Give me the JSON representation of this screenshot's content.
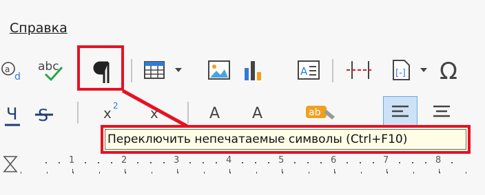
{
  "menu": {
    "help_label": "Справка"
  },
  "tooltip": {
    "text": "Переключить непечатаемые символы (Ctrl+F10)"
  },
  "ruler": {
    "labels": [
      "1",
      "2",
      "3",
      "4",
      "5",
      "6",
      "7",
      "8"
    ]
  },
  "colors": {
    "highlight": "#e81123",
    "tooltip_bg": "#fffde6",
    "accent_blue": "#2f7bd8",
    "check_green": "#27a844"
  },
  "icons": {
    "row1": [
      "autocorrect-icon",
      "spellcheck-icon",
      "formatting-marks-icon",
      "table-icon",
      "image-icon",
      "chart-icon",
      "textbox-icon",
      "page-break-icon",
      "field-icon",
      "special-char-icon"
    ],
    "row2": [
      "underline-icon",
      "strikethrough-icon",
      "superscript-icon",
      "subscript-icon",
      "font-color-icon",
      "highlight-color-icon",
      "align-left-icon",
      "align-center-icon"
    ]
  }
}
